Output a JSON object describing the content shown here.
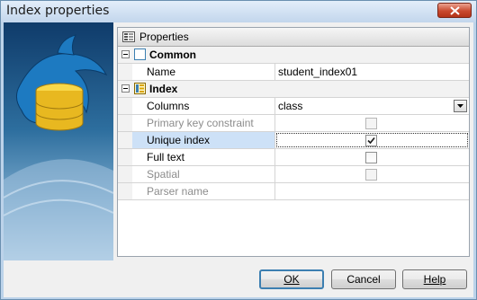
{
  "window": {
    "title": "Index properties"
  },
  "grid": {
    "header_label": "Properties",
    "categories": [
      {
        "label": "Common",
        "rows": [
          {
            "name": "Name",
            "value": "student_index01"
          }
        ]
      },
      {
        "label": "Index",
        "rows": [
          {
            "name": "Columns",
            "value": "class"
          },
          {
            "name": "Primary key constraint",
            "checked": false,
            "enabled": false
          },
          {
            "name": "Unique index",
            "checked": true,
            "enabled": true,
            "selected": true
          },
          {
            "name": "Full text",
            "checked": false,
            "enabled": true
          },
          {
            "name": "Spatial",
            "checked": false,
            "enabled": false
          },
          {
            "name": "Parser name",
            "value": "",
            "enabled": false
          }
        ]
      }
    ]
  },
  "buttons": {
    "ok": "OK",
    "cancel": "Cancel",
    "help": "Help"
  },
  "icons": {
    "close": "close-icon",
    "logo": "mysql-dolphin-database-logo",
    "header": "properties-icon",
    "common": "common-category-icon",
    "index": "index-category-icon"
  },
  "colors": {
    "selected_row": "#cde1f7",
    "default_button_border": "#3c7fb1",
    "close_button": "#c9492e"
  }
}
